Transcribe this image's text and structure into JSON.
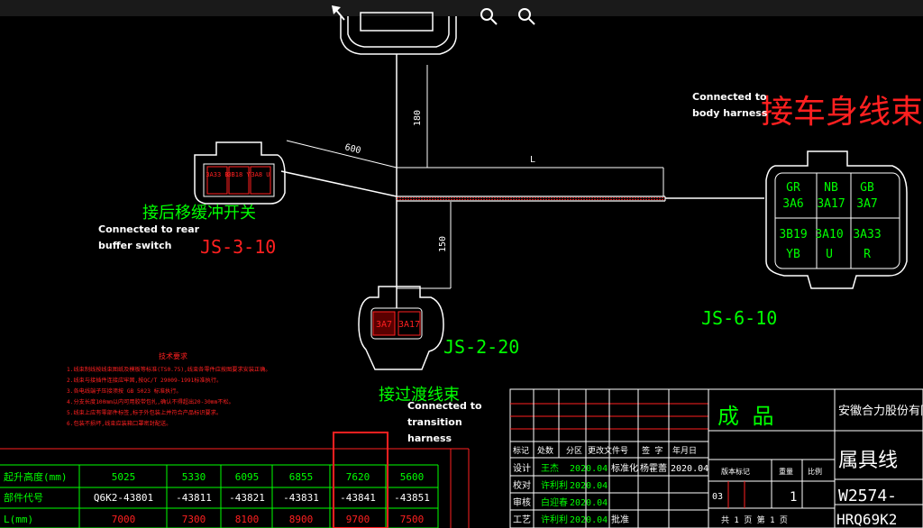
{
  "toolbar": {
    "icons": [
      "arrow-icon",
      "zoom-in-icon",
      "zoom-out-icon"
    ]
  },
  "labels": {
    "body_harness_cn": "接车身线束",
    "body_harness_en_1": "Connected to",
    "body_harness_en_2": "body harness",
    "rear_buffer_cn": "接后移缓冲开关",
    "rear_buffer_en_1": "Connected to rear",
    "rear_buffer_en_2": "buffer switch",
    "transition_cn": "接过渡线束",
    "transition_en_1": "Connected to",
    "transition_en_2": "transition",
    "transition_en_3": "harness"
  },
  "dimensions": {
    "d180": "180",
    "d600": "600",
    "dL": "L",
    "d150": "150"
  },
  "connectors": {
    "js3": {
      "id": "JS-3-10",
      "pins": [
        "3A33 B",
        "3B18 Y",
        "3A8 U"
      ]
    },
    "js2": {
      "id": "JS-2-20",
      "pins": [
        "3A7",
        "3A17"
      ]
    },
    "js6": {
      "id": "JS-6-10",
      "pins": [
        [
          "GR",
          "3A6"
        ],
        [
          "NB",
          "3A17"
        ],
        [
          "GB",
          "3A7"
        ],
        [
          "3B19",
          "YB"
        ],
        [
          "3A10",
          "U"
        ],
        [
          "3A33",
          "R"
        ]
      ]
    }
  },
  "notes": {
    "title": "技术要求",
    "lines": [
      "1.线束制线按线束图纸及模板等标准(TS0.75),线束各零件应按图要求安装正确。",
      "2.线束与接插件连接应牢固,按QC/T 29009-1991标准执行。",
      "3.各电线端子压接须按 GB 5023 标准执行。",
      "4.分支长度100mm以内可用胶带包扎,确认不得超出20-30mm不松。",
      "5.线束上应有零部件标签,标于外包装上并符合产品标识要求。",
      "6.包装不损坏,线束应装箱口罩密封配送。"
    ]
  },
  "spec_table": {
    "rows": [
      {
        "label": "起升高度(mm)",
        "values": [
          "5025",
          "5330",
          "6095",
          "6855",
          "7620",
          "5600"
        ],
        "color": "#00ff00"
      },
      {
        "label": "部件代号",
        "values": [
          "Q6K2-43801",
          "-43811",
          "-43821",
          "-43831",
          "-43841",
          "-43851"
        ],
        "color": "#ffffff"
      },
      {
        "label": "L(mm)",
        "values": [
          "7000",
          "7300",
          "8100",
          "8900",
          "9700",
          "7500"
        ],
        "color": "#ff2020"
      }
    ]
  },
  "title_block": {
    "company": "安徽合力股份有限",
    "product_type": "成 品",
    "part_name": "属具线",
    "drawing_no": "W2574-",
    "drawing_code": "HRQ69K2",
    "headers": [
      "标记",
      "处数",
      "分区",
      "更改文件号",
      "签 字",
      "年月日"
    ],
    "rows": [
      {
        "role": "设计",
        "name": "王杰",
        "date": "2020.04",
        "role2": "标准化",
        "name2": "杨霍蕾",
        "date2": "2020.04"
      },
      {
        "role": "校对",
        "name": "许利利",
        "date": "2020.04"
      },
      {
        "role": "审核",
        "name": "白迎春",
        "date": "2020.04"
      },
      {
        "role": "工艺",
        "name": "许利利",
        "date": "2020.04",
        "role2": "批准"
      }
    ],
    "stage_label": "版本标记",
    "weight_label": "重量",
    "scale_label": "比例",
    "stage_value": "03",
    "count": "1",
    "sheet_text": "共 1 页  第 1 页"
  }
}
